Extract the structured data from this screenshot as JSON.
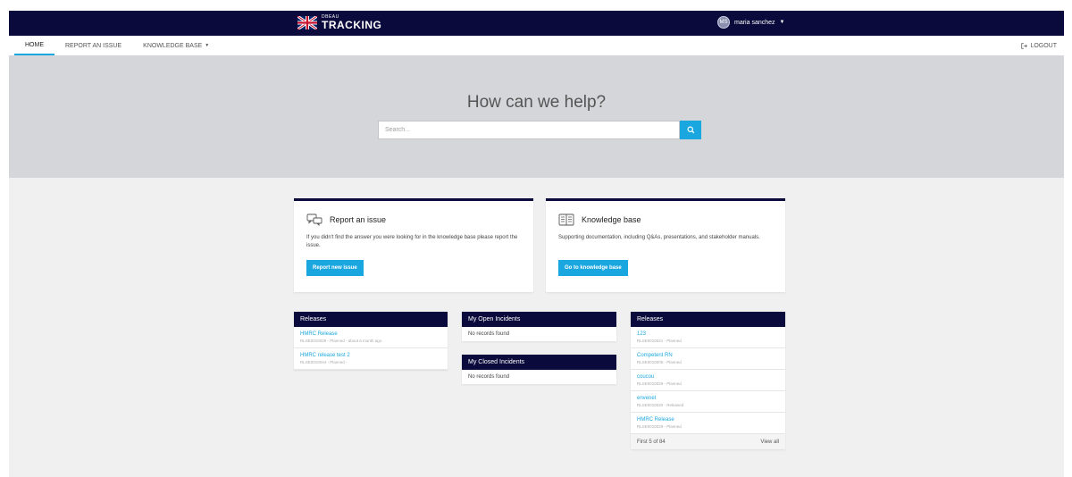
{
  "brand": {
    "small_text": "DBEAU",
    "name": "TRACKING"
  },
  "user": {
    "initials": "MS",
    "name": "maria sanchez"
  },
  "nav": {
    "items": [
      {
        "label": "HOME"
      },
      {
        "label": "REPORT AN ISSUE"
      },
      {
        "label": "KNOWLEDGE BASE"
      }
    ],
    "logout": "LOGOUT"
  },
  "hero": {
    "title": "How can we help?",
    "search_placeholder": "Search..."
  },
  "cards": {
    "report": {
      "title": "Report an issue",
      "description": "If you didn't find the answer you were looking for in the knowledge base please report the issue.",
      "button": "Report new issue"
    },
    "knowledge": {
      "title": "Knowledge base",
      "description": "Supporting documentation, including Q&As, presentations, and stakeholder manuals.",
      "button": "Go to knowledge base"
    }
  },
  "releases_left": {
    "title": "Releases",
    "items": [
      {
        "title": "HMRC Release",
        "sub": "RLSE0010029 - Planned - about a month ago"
      },
      {
        "title": "HMRC release test 2",
        "sub": "RLSE0010044 - Planned -"
      }
    ]
  },
  "open_incidents": {
    "title": "My Open Incidents",
    "empty": "No records found"
  },
  "closed_incidents": {
    "title": "My Closed Incidents",
    "empty": "No records found"
  },
  "releases_right": {
    "title": "Releases",
    "items": [
      {
        "title": "123",
        "sub": "RLSE0010021 - Planned"
      },
      {
        "title": "Competent RN",
        "sub": "RLSE0010005 - Planned"
      },
      {
        "title": "coucou",
        "sub": "RLSE0010026 - Planned"
      },
      {
        "title": "envenet",
        "sub": "RLSE0010020 - Released"
      },
      {
        "title": "HMRC Release",
        "sub": "RLSE0010029 - Planned"
      }
    ],
    "footer_count": "First 5 of 84",
    "view_all": "View all"
  },
  "colors": {
    "navy": "#0a0a3c",
    "accent": "#1aa7e0",
    "hero_bg": "#d5d6d9",
    "page_bg": "#f0f0f1"
  }
}
